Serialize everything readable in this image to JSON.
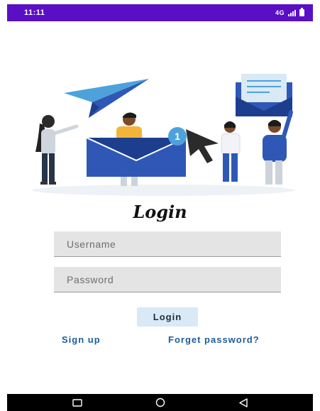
{
  "status_bar": {
    "time": "11:11",
    "network": "4G",
    "background": "#5b0fc4"
  },
  "illustration": {
    "icons": [
      "paper-plane-icon",
      "envelope-icon",
      "notification-badge-icon",
      "cursor-icon",
      "open-envelope-icon",
      "people-figures"
    ],
    "badge_count": "1"
  },
  "title": "Login",
  "form": {
    "username_placeholder": "Username",
    "password_placeholder": "Password",
    "login_label": "Login"
  },
  "links": {
    "sign_up": "Sign up",
    "forget_password": "Forget password?"
  },
  "nav_bar": {
    "icons": [
      "recent-apps-icon",
      "home-icon",
      "back-icon"
    ]
  },
  "colors": {
    "accent_link": "#1e5d9a",
    "button_bg": "#d9e9f5",
    "field_bg": "#e4e4e4",
    "illustration_blue": "#2f58b6"
  }
}
